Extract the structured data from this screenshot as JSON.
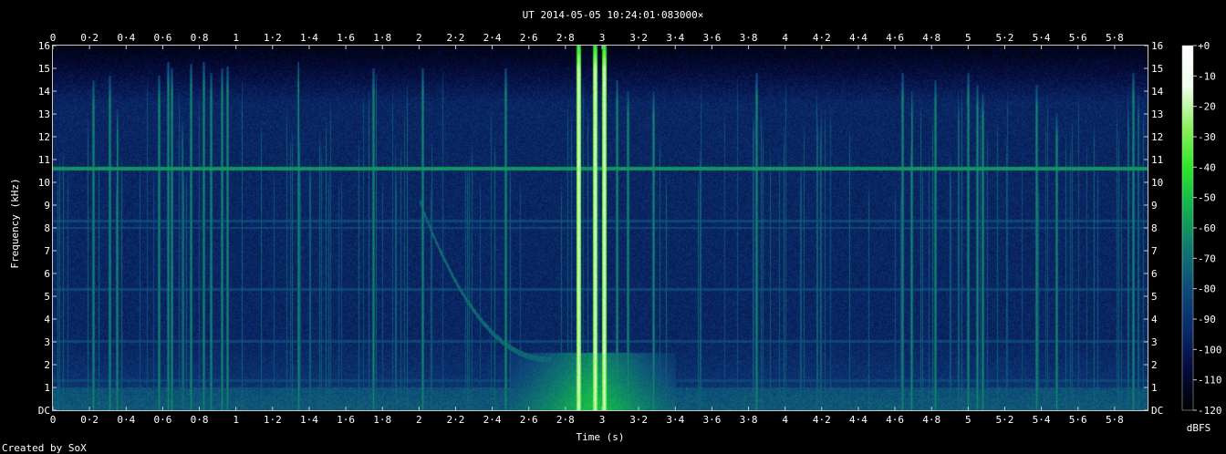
{
  "chart_data": {
    "type": "heatmap",
    "title": "UT 2014-05-05 10:24:01·083000×",
    "xlabel": "Time (s)",
    "ylabel": "Frequency (kHz)",
    "xlim": [
      0,
      5.98
    ],
    "ylim": [
      0,
      16
    ],
    "xticks": [
      "0",
      "0·2",
      "0·4",
      "0·6",
      "0·8",
      "1",
      "1·2",
      "1·4",
      "1·6",
      "1·8",
      "2",
      "2·2",
      "2·4",
      "2·6",
      "2·8",
      "3",
      "3·2",
      "3·4",
      "3·6",
      "3·8",
      "4",
      "4·2",
      "4·4",
      "4·6",
      "4·8",
      "5",
      "5·2",
      "5·4",
      "5·6",
      "5·8"
    ],
    "yticks": [
      "DC",
      "1",
      "2",
      "3",
      "4",
      "5",
      "6",
      "7",
      "8",
      "9",
      "10",
      "11",
      "12",
      "13",
      "14",
      "15",
      "16"
    ],
    "colorbar": {
      "label": "dBFS",
      "ticks": [
        "+0",
        "-10",
        "-20",
        "-30",
        "-40",
        "-50",
        "-60",
        "-70",
        "-80",
        "-90",
        "-100",
        "-110",
        "-120"
      ],
      "range": [
        -120,
        0
      ],
      "colors": [
        "#000000",
        "#050a3a",
        "#0a2a6a",
        "#0e4a7a",
        "#0e7a6e",
        "#14b050",
        "#2ee62a",
        "#8ef060",
        "#f0fff0",
        "#ffffff"
      ]
    },
    "features": {
      "background_level_dbfs": -95,
      "continuous_tone": {
        "freq_khz": 10.6,
        "level_dbfs": -60
      },
      "harmonic_bands_khz": [
        8.3,
        8.0,
        5.3,
        3.0,
        1.3,
        0.8,
        0.5
      ],
      "strong_transients": [
        {
          "t": 2.87,
          "f_max_khz": 16,
          "level_dbfs": -15
        },
        {
          "t": 2.96,
          "f_max_khz": 16,
          "level_dbfs": -15
        },
        {
          "t": 3.01,
          "f_max_khz": 16,
          "level_dbfs": -15
        }
      ],
      "medium_transients": [
        {
          "t": 0.22,
          "f_max": 14.5
        },
        {
          "t": 0.31,
          "f_max": 14.7
        },
        {
          "t": 0.35,
          "f_max": 13.2
        },
        {
          "t": 0.58,
          "f_max": 14.7
        },
        {
          "t": 0.63,
          "f_max": 15.3
        },
        {
          "t": 0.65,
          "f_max": 15.0
        },
        {
          "t": 0.75,
          "f_max": 15.2
        },
        {
          "t": 0.82,
          "f_max": 15.3
        },
        {
          "t": 0.86,
          "f_max": 14.8
        },
        {
          "t": 0.92,
          "f_max": 15.0
        },
        {
          "t": 0.95,
          "f_max": 15.1
        },
        {
          "t": 1.34,
          "f_max": 15.3
        },
        {
          "t": 1.75,
          "f_max": 15.0
        },
        {
          "t": 2.02,
          "f_max": 15.0
        },
        {
          "t": 2.47,
          "f_max": 15.0
        },
        {
          "t": 3.08,
          "f_max": 14.5
        },
        {
          "t": 3.14,
          "f_max": 14.0
        },
        {
          "t": 3.28,
          "f_max": 14.0
        },
        {
          "t": 3.84,
          "f_max": 14.8
        },
        {
          "t": 4.64,
          "f_max": 14.8
        },
        {
          "t": 4.69,
          "f_max": 14.0
        },
        {
          "t": 4.82,
          "f_max": 14.5
        },
        {
          "t": 5.0,
          "f_max": 14.8
        },
        {
          "t": 5.05,
          "f_max": 14.3
        },
        {
          "t": 5.08,
          "f_max": 13.9
        },
        {
          "t": 5.37,
          "f_max": 14.3
        },
        {
          "t": 5.48,
          "f_max": 13.0
        },
        {
          "t": 5.9,
          "f_max": 14.8
        }
      ],
      "chirp": {
        "t_start": 2.0,
        "f_start_khz": 9.2,
        "t_end": 2.72,
        "f_end_khz": 2.2
      }
    }
  },
  "credit": "Created by SoX"
}
